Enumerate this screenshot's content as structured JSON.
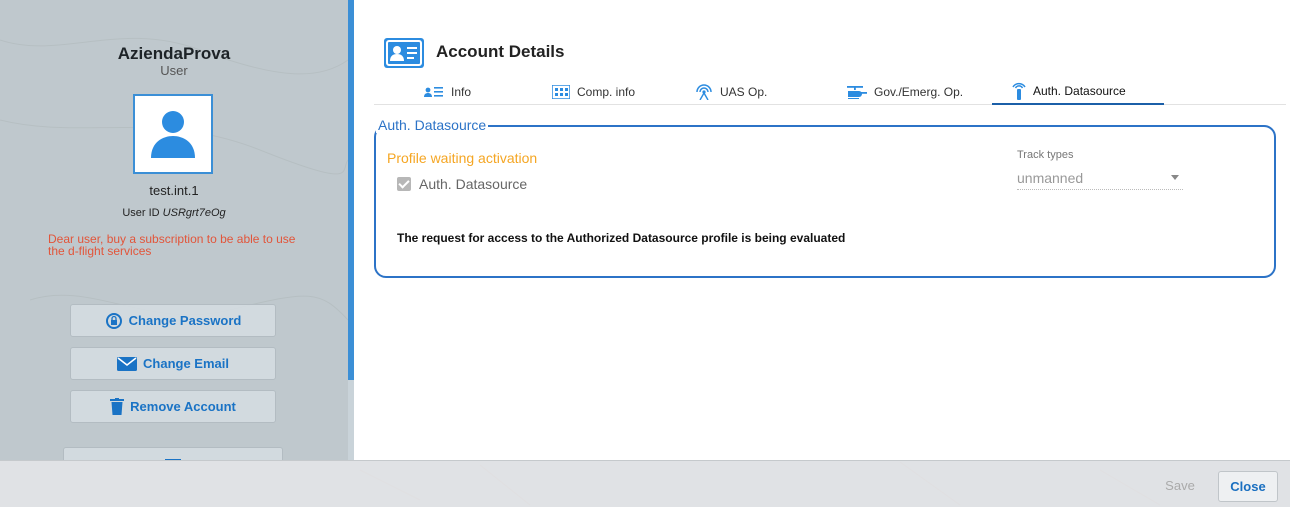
{
  "sidebar": {
    "company": "AziendaProva",
    "role": "User",
    "username": "test.int.1",
    "user_id_label": "User ID",
    "user_id_value": "USRgrt7eOg",
    "subscription_warning": "Dear user, buy a subscription to be able to use the d-flight services",
    "change_password": "Change Password",
    "change_email": "Change Email",
    "remove_account": "Remove Account"
  },
  "dialog": {
    "title": "Account Details",
    "tabs": [
      {
        "label": "Info",
        "icon": "person-list-icon"
      },
      {
        "label": "Comp. info",
        "icon": "building-icon"
      },
      {
        "label": "UAS Op.",
        "icon": "antenna-icon"
      },
      {
        "label": "Gov./Emerg. Op.",
        "icon": "helicopter-icon"
      },
      {
        "label": "Auth. Datasource",
        "icon": "signal-tower-icon"
      }
    ],
    "active_tab": "Auth. Datasource",
    "section": {
      "legend": "Auth. Datasource",
      "status": "Profile waiting activation",
      "checkbox_label": "Auth. Datasource",
      "checkbox_checked": true,
      "track_types_label": "Track types",
      "track_types_value": "unmanned",
      "message": "The request for access to the Authorized Datasource profile is being evaluated"
    }
  },
  "footer": {
    "save": "Save",
    "close": "Close"
  },
  "colors": {
    "accent": "#2c73c7",
    "warning": "#f5a623",
    "error": "#e2553a"
  }
}
